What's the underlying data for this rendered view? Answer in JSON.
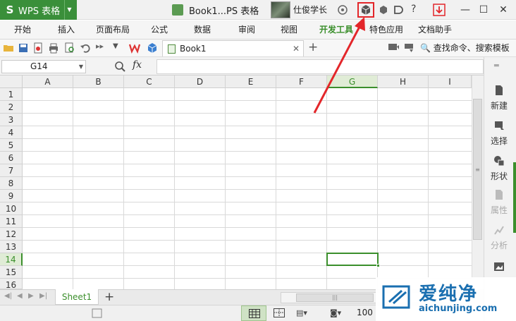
{
  "titlebar": {
    "app_name": "WPS 表格",
    "app_logo": "S",
    "doc_title": "Book1...PS 表格",
    "username": "仕俊学长",
    "window_buttons": [
      "—",
      "☐",
      "✕"
    ]
  },
  "ribbon": {
    "tabs": [
      "开始",
      "插入",
      "页面布局",
      "公式",
      "数据",
      "审阅",
      "视图",
      "开发工具",
      "特色应用",
      "文档助手"
    ],
    "active_tab": "开发工具"
  },
  "toolbar": {
    "file_tab": "Book1",
    "search_command": "查找命令、搜索模板"
  },
  "formula_bar": {
    "name_box": "G14",
    "fx_label": "fx",
    "formula": ""
  },
  "grid": {
    "columns": [
      "A",
      "B",
      "C",
      "D",
      "E",
      "F",
      "G",
      "H",
      "I"
    ],
    "rows": [
      "1",
      "2",
      "3",
      "4",
      "5",
      "6",
      "7",
      "8",
      "9",
      "10",
      "11",
      "12",
      "13",
      "14",
      "15",
      "16"
    ],
    "selected_column": "G",
    "selected_row": "14"
  },
  "right_panel": {
    "items": [
      {
        "label": "新建",
        "icon": "new-doc-icon"
      },
      {
        "label": "选择",
        "icon": "select-icon"
      },
      {
        "label": "形状",
        "icon": "shapes-icon"
      },
      {
        "label": "属性",
        "icon": "properties-icon"
      },
      {
        "label": "分析",
        "icon": "analysis-icon"
      },
      {
        "label": "",
        "icon": "image-icon"
      }
    ]
  },
  "sheets": {
    "tabs": [
      "Sheet1"
    ],
    "add_label": "+"
  },
  "status": {
    "zoom": "100"
  },
  "watermark": {
    "brand": "爱纯净",
    "url": "aichunjing.com"
  },
  "colors": {
    "accent_green": "#3b8f2c",
    "highlight_red": "#e3262a",
    "brand_blue": "#1a6fb0"
  }
}
